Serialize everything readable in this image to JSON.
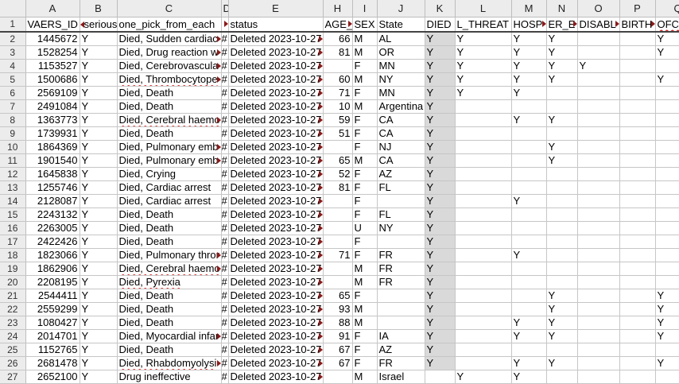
{
  "column_letters": [
    "A",
    "B",
    "C",
    "D",
    "E",
    "H",
    "I",
    "J",
    "K",
    "L",
    "M",
    "N",
    "O",
    "P",
    "Q"
  ],
  "headers": [
    {
      "text": "VAERS_ID",
      "arrow": false
    },
    {
      "text": "serious",
      "arrowLeft": true
    },
    {
      "text": "one_pick_from_each",
      "arrow": false
    },
    {
      "text": "",
      "arrow": true
    },
    {
      "text": "status",
      "arrow": false
    },
    {
      "text": "AGE_",
      "arrow": true
    },
    {
      "text": "SEX",
      "arrow": false
    },
    {
      "text": "State",
      "arrow": false
    },
    {
      "text": "DIED",
      "arrow": false
    },
    {
      "text": "L_THREAT",
      "arrow": false
    },
    {
      "text": "HOSP",
      "arrow": true
    },
    {
      "text": "ER_E",
      "arrow": true
    },
    {
      "text": "DISABL",
      "arrow": true
    },
    {
      "text": "BIRTH",
      "arrow": true
    },
    {
      "text": "OFC",
      "arrow": false,
      "spell": true
    }
  ],
  "rows": [
    {
      "n": "2",
      "id": "1445672",
      "b": "Y",
      "c": "Died, Sudden cardiac",
      "ct": true,
      "d": "#",
      "e": "Deleted 2023-10-27",
      "h": "66",
      "i": "M",
      "j": "AL",
      "k": "Y",
      "l": "Y",
      "m": "Y",
      "nn": "Y",
      "o": "",
      "p": "",
      "q": "Y"
    },
    {
      "n": "3",
      "id": "1528254",
      "b": "Y",
      "c": "Died, Drug reaction w",
      "ct": true,
      "d": "#",
      "e": "Deleted 2023-10-27",
      "h": "81",
      "i": "M",
      "j": "OR",
      "k": "Y",
      "l": "Y",
      "m": "Y",
      "nn": "Y",
      "o": "",
      "p": "",
      "q": "Y"
    },
    {
      "n": "4",
      "id": "1153527",
      "b": "Y",
      "c": "Died, Cerebrovascula",
      "ct": true,
      "d": "#",
      "e": "Deleted 2023-10-27",
      "h": "",
      "i": "F",
      "j": "MN",
      "k": "Y",
      "l": "Y",
      "m": "Y",
      "nn": "Y",
      "o": "Y",
      "p": "",
      "q": ""
    },
    {
      "n": "5",
      "id": "1500686",
      "b": "Y",
      "c": "Died, Thrombocytope",
      "ct": true,
      "cs": true,
      "d": "#",
      "e": "Deleted 2023-10-27",
      "h": "60",
      "i": "M",
      "j": "NY",
      "k": "Y",
      "l": "Y",
      "m": "Y",
      "nn": "Y",
      "o": "",
      "p": "",
      "q": "Y"
    },
    {
      "n": "6",
      "id": "2569109",
      "b": "Y",
      "c": "Died, Death",
      "d": "#",
      "e": "Deleted 2023-10-27",
      "h": "71",
      "i": "F",
      "j": "MN",
      "k": "Y",
      "l": "Y",
      "m": "Y",
      "nn": "",
      "o": "",
      "p": "",
      "q": ""
    },
    {
      "n": "7",
      "id": "2491084",
      "b": "Y",
      "c": "Died, Death",
      "d": "#",
      "e": "Deleted 2023-10-27",
      "h": "10",
      "i": "M",
      "j": "Argentina",
      "k": "Y",
      "l": "",
      "m": "",
      "nn": "",
      "o": "",
      "p": "",
      "q": ""
    },
    {
      "n": "8",
      "id": "1363773",
      "b": "Y",
      "c": "Died, Cerebral haemo",
      "ct": true,
      "cs": true,
      "d": "#",
      "e": "Deleted 2023-10-27",
      "h": "59",
      "i": "F",
      "j": "CA",
      "k": "Y",
      "l": "",
      "m": "Y",
      "nn": "Y",
      "o": "",
      "p": "",
      "q": ""
    },
    {
      "n": "9",
      "id": "1739931",
      "b": "Y",
      "c": "Died, Death",
      "d": "#",
      "e": "Deleted 2023-10-27",
      "h": "51",
      "i": "F",
      "j": "CA",
      "k": "Y",
      "l": "",
      "m": "",
      "nn": "",
      "o": "",
      "p": "",
      "q": ""
    },
    {
      "n": "10",
      "id": "1864369",
      "b": "Y",
      "c": "Died, Pulmonary emb",
      "ct": true,
      "d": "#",
      "e": "Deleted 2023-10-27",
      "h": "",
      "i": "F",
      "j": "NJ",
      "k": "Y",
      "l": "",
      "m": "",
      "nn": "Y",
      "o": "",
      "p": "",
      "q": ""
    },
    {
      "n": "11",
      "id": "1901540",
      "b": "Y",
      "c": "Died, Pulmonary emb",
      "ct": true,
      "d": "#",
      "e": "Deleted 2023-10-27",
      "h": "65",
      "i": "M",
      "j": "CA",
      "k": "Y",
      "l": "",
      "m": "",
      "nn": "Y",
      "o": "",
      "p": "",
      "q": ""
    },
    {
      "n": "12",
      "id": "1645838",
      "b": "Y",
      "c": "Died, Crying",
      "d": "#",
      "e": "Deleted 2023-10-27",
      "h": "52",
      "i": "F",
      "j": "AZ",
      "k": "Y",
      "l": "",
      "m": "",
      "nn": "",
      "o": "",
      "p": "",
      "q": ""
    },
    {
      "n": "13",
      "id": "1255746",
      "b": "Y",
      "c": "Died, Cardiac arrest",
      "d": "#",
      "e": "Deleted 2023-10-27",
      "h": "81",
      "i": "F",
      "j": "FL",
      "k": "Y",
      "l": "",
      "m": "",
      "nn": "",
      "o": "",
      "p": "",
      "q": ""
    },
    {
      "n": "14",
      "id": "2128087",
      "b": "Y",
      "c": "Died, Cardiac arrest",
      "d": "#",
      "e": "Deleted 2023-10-27",
      "h": "",
      "i": "F",
      "j": "",
      "k": "Y",
      "l": "",
      "m": "Y",
      "nn": "",
      "o": "",
      "p": "",
      "q": ""
    },
    {
      "n": "15",
      "id": "2243132",
      "b": "Y",
      "c": "Died, Death",
      "d": "#",
      "e": "Deleted 2023-10-27",
      "h": "",
      "i": "F",
      "j": "FL",
      "k": "Y",
      "l": "",
      "m": "",
      "nn": "",
      "o": "",
      "p": "",
      "q": ""
    },
    {
      "n": "16",
      "id": "2263005",
      "b": "Y",
      "c": "Died, Death",
      "d": "#",
      "e": "Deleted 2023-10-27",
      "h": "",
      "i": "U",
      "j": "NY",
      "k": "Y",
      "l": "",
      "m": "",
      "nn": "",
      "o": "",
      "p": "",
      "q": ""
    },
    {
      "n": "17",
      "id": "2422426",
      "b": "Y",
      "c": "Died, Death",
      "d": "#",
      "e": "Deleted 2023-10-27",
      "h": "",
      "i": "F",
      "j": "",
      "k": "Y",
      "l": "",
      "m": "",
      "nn": "",
      "o": "",
      "p": "",
      "q": ""
    },
    {
      "n": "18",
      "id": "1823066",
      "b": "Y",
      "c": "Died, Pulmonary thror",
      "ct": true,
      "d": "#",
      "e": "Deleted 2023-10-27",
      "h": "71",
      "i": "F",
      "j": "FR",
      "k": "Y",
      "l": "",
      "m": "Y",
      "nn": "",
      "o": "",
      "p": "",
      "q": ""
    },
    {
      "n": "19",
      "id": "1862906",
      "b": "Y",
      "c": "Died, Cerebral haemo",
      "ct": true,
      "cs": true,
      "d": "#",
      "e": "Deleted 2023-10-27",
      "h": "",
      "i": "M",
      "j": "FR",
      "k": "Y",
      "l": "",
      "m": "",
      "nn": "",
      "o": "",
      "p": "",
      "q": ""
    },
    {
      "n": "20",
      "id": "2208195",
      "b": "Y",
      "c": "Died, Pyrexia",
      "cs": true,
      "d": "#",
      "e": "Deleted 2023-10-27",
      "h": "",
      "i": "M",
      "j": "FR",
      "k": "Y",
      "l": "",
      "m": "",
      "nn": "",
      "o": "",
      "p": "",
      "q": ""
    },
    {
      "n": "21",
      "id": "2544411",
      "b": "Y",
      "c": "Died, Death",
      "d": "#",
      "e": "Deleted 2023-10-27",
      "h": "65",
      "i": "F",
      "j": "",
      "k": "Y",
      "l": "",
      "m": "",
      "nn": "Y",
      "o": "",
      "p": "",
      "q": "Y"
    },
    {
      "n": "22",
      "id": "2559299",
      "b": "Y",
      "c": "Died, Death",
      "d": "#",
      "e": "Deleted 2023-10-27",
      "h": "93",
      "i": "M",
      "j": "",
      "k": "Y",
      "l": "",
      "m": "",
      "nn": "Y",
      "o": "",
      "p": "",
      "q": "Y"
    },
    {
      "n": "23",
      "id": "1080427",
      "b": "Y",
      "c": "Died, Death",
      "d": "#",
      "e": "Deleted 2023-10-27",
      "h": "88",
      "i": "M",
      "j": "",
      "k": "Y",
      "l": "",
      "m": "Y",
      "nn": "Y",
      "o": "",
      "p": "",
      "q": "Y"
    },
    {
      "n": "24",
      "id": "2014701",
      "b": "Y",
      "c": "Died, Myocardial infar",
      "ct": true,
      "d": "#",
      "e": "Deleted 2023-10-27",
      "h": "91",
      "i": "F",
      "j": "IA",
      "k": "Y",
      "l": "",
      "m": "Y",
      "nn": "Y",
      "o": "",
      "p": "",
      "q": "Y"
    },
    {
      "n": "25",
      "id": "1152765",
      "b": "Y",
      "c": "Died, Death",
      "d": "#",
      "e": "Deleted 2023-10-27",
      "h": "67",
      "i": "F",
      "j": "AZ",
      "k": "Y",
      "l": "",
      "m": "",
      "nn": "",
      "o": "",
      "p": "",
      "q": ""
    },
    {
      "n": "26",
      "id": "2681478",
      "b": "Y",
      "c": "Died, Rhabdomyolysi",
      "ct": true,
      "cs": true,
      "d": "#",
      "e": "Deleted 2023-10-27",
      "h": "67",
      "i": "F",
      "j": "FR",
      "k": "Y",
      "l": "",
      "m": "Y",
      "nn": "Y",
      "o": "",
      "p": "",
      "q": "Y"
    },
    {
      "n": "27",
      "id": "2652100",
      "b": "Y",
      "c": "Drug ineffective",
      "d": "#",
      "e": "Deleted 2023-10-27",
      "h": "",
      "i": "M",
      "j": "Israel",
      "k": "",
      "l": "Y",
      "m": "Y",
      "nn": "",
      "o": "",
      "p": "",
      "q": ""
    }
  ]
}
